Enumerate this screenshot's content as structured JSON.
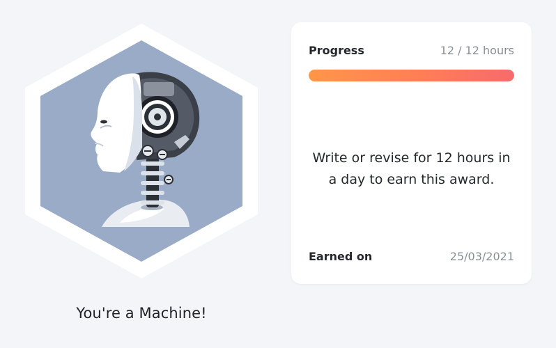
{
  "award": {
    "title": "You're a Machine!",
    "badge_icon": "robot-hexagon-badge-icon",
    "colors": {
      "hex_outer": "#ffffff",
      "hex_inner": "#99abc7"
    }
  },
  "details": {
    "progress_label": "Progress",
    "progress_value": "12 / 12 hours",
    "progress_fraction": 1.0,
    "description": "Write or revise for 12 hours in a day to earn this award.",
    "earned_label": "Earned on",
    "earned_date": "25/03/2021"
  },
  "colors": {
    "background": "#f3f5f8",
    "progress_start": "#ff9648",
    "progress_end": "#f76a6c"
  }
}
